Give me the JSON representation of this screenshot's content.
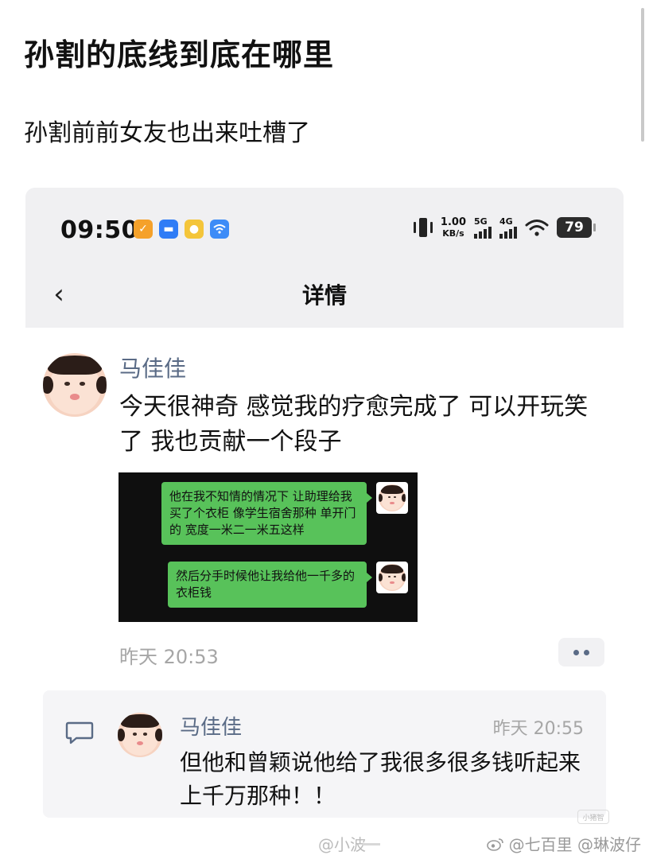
{
  "post": {
    "title": "孙割的底线到底在哪里",
    "subtitle": "孙割前前女友也出来吐槽了"
  },
  "screenshot": {
    "status_bar": {
      "time": "09:50",
      "net_speed_value": "1.00",
      "net_speed_unit": "KB/s",
      "signal1_label": "5G",
      "signal2_label": "4G",
      "battery": "79",
      "app_icons": [
        "orange-app-icon",
        "blue-chat-icon",
        "yellow-bulb-icon",
        "wifi-app-icon"
      ]
    },
    "nav": {
      "back_symbol": "‹",
      "title": "详情"
    },
    "post": {
      "author": "马佳佳",
      "text": "今天很神奇 感觉我的疗愈完成了 可以开玩笑了 我也贡献一个段子",
      "time": "昨天 20:53",
      "chat_image": {
        "messages": [
          "他在我不知情的情况下 让助理给我买了个衣柜 像学生宿舍那种 单开门的 宽度一米二一米五这样",
          "然后分手时候他让我给他一千多的衣柜钱"
        ]
      }
    },
    "reply": {
      "author": "马佳佳",
      "time": "昨天 20:55",
      "text": "但他和曾颖说他给了我很多很多钱听起来上千万那种！！"
    }
  },
  "watermark": {
    "text": "@七百里 @琳波仔",
    "blurred": "@小波",
    "corner_mark": "小猪智"
  },
  "colors": {
    "status_bg": "#f0f0f2",
    "author_blue": "#5a6b86",
    "wechat_green": "#58c25a",
    "muted_gray": "#a6a6a6"
  }
}
